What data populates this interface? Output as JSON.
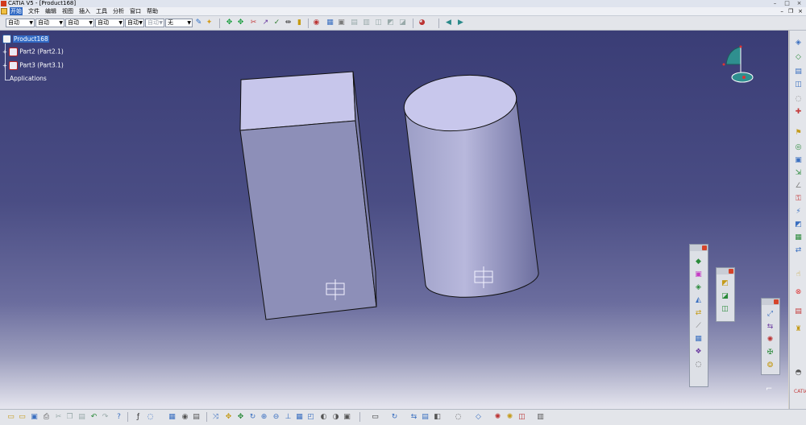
{
  "window": {
    "title": "CATIA V5 - [Product168]",
    "min": "–",
    "max": "□",
    "close": "×"
  },
  "menubar": {
    "items": [
      "开始",
      "文件",
      "编辑",
      "视图",
      "插入",
      "工具",
      "分析",
      "窗口",
      "帮助"
    ],
    "active_index": 0
  },
  "toolbar_top": {
    "combos": [
      {
        "value": "自动",
        "disabled": false
      },
      {
        "value": "自动",
        "disabled": false
      },
      {
        "value": "自动",
        "disabled": false
      },
      {
        "value": "自动",
        "disabled": false
      },
      {
        "value": "自动",
        "disabled": false
      },
      {
        "value": "自动",
        "disabled": true
      },
      {
        "value": "无",
        "disabled": false
      }
    ]
  },
  "tree": {
    "root": "Product168",
    "children": [
      "Part2 (Part2.1)",
      "Part3 (Part3.1)"
    ],
    "applications": "Applications"
  },
  "colors": {
    "accent": "#316ac5",
    "viewport_top": "#3a3d76",
    "viewport_bottom": "#e6e6ef",
    "part_face": "#8d8fb8",
    "part_top": "#c7c6eb"
  },
  "brand": "CATIA"
}
